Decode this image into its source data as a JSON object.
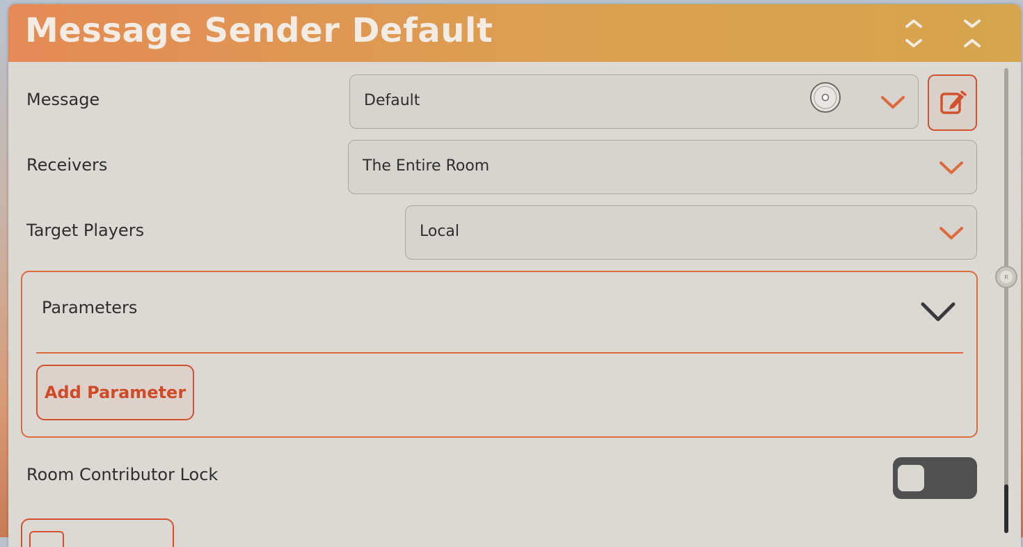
{
  "window": {
    "title": "Message Sender Default",
    "expand_icon": "unfold-icon",
    "collapse_icon": "fold-icon"
  },
  "fields": {
    "message": {
      "label": "Message",
      "value": "Default"
    },
    "receivers": {
      "label": "Receivers",
      "value": "The Entire Room"
    },
    "target_players": {
      "label": "Target Players",
      "value": "Local"
    }
  },
  "edit_button": {
    "icon": "edit-pencil-icon"
  },
  "parameters": {
    "label": "Parameters",
    "add_button_label": "Add Parameter"
  },
  "room_contributor_lock": {
    "label": "Room Contributor Lock",
    "enabled": false
  },
  "colors": {
    "accent": "#dd6a3d",
    "title_gradient_start": "#e48b55",
    "title_gradient_end": "#d6a54c",
    "panel_bg": "#dcd9d4",
    "toggle_off": "#505050"
  }
}
